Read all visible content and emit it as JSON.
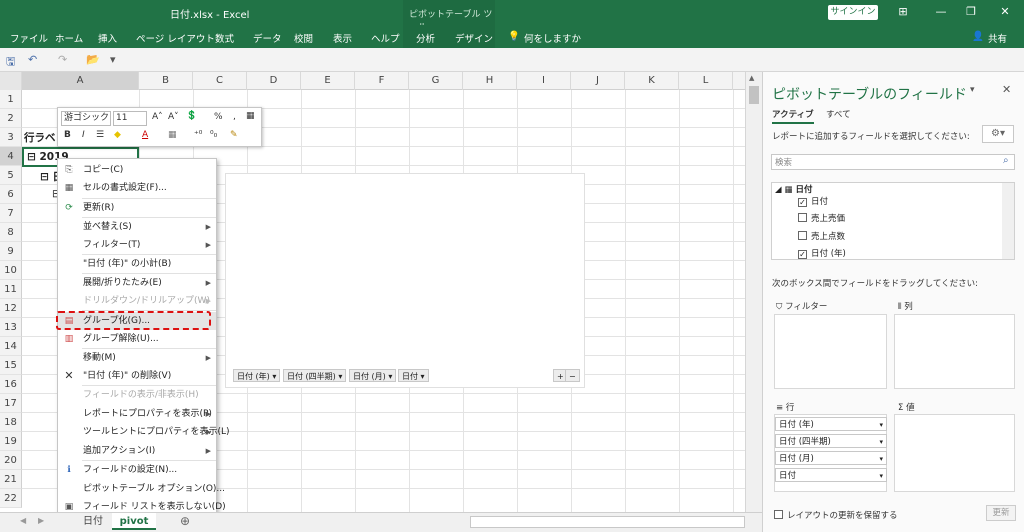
{
  "window": {
    "title": "日付.xlsx  -  Excel",
    "context_tab_group": "ピボットテーブル ツール",
    "signin": "サインイン",
    "controls": {
      "restore_ribbon": "⊞",
      "minimize": "—",
      "maximize": "❐",
      "close": "✕"
    }
  },
  "ribbon": {
    "tabs": [
      "ファイル",
      "ホーム",
      "挿入",
      "ページ レイアウト",
      "数式",
      "データ",
      "校閲",
      "表示",
      "ヘルプ",
      "分析",
      "デザイン"
    ],
    "tell_me": "何をしますか",
    "share": "共有"
  },
  "qat": {
    "save": "🖫",
    "undo": "↶",
    "redo": "↷",
    "open": "📂",
    "custom": "▾"
  },
  "name_box": "",
  "grid": {
    "columns": [
      "A",
      "B",
      "C",
      "D",
      "E",
      "F",
      "G",
      "H",
      "I",
      "J",
      "K",
      "L"
    ],
    "rows": [
      "1",
      "2",
      "3",
      "4",
      "5",
      "6",
      "7",
      "8",
      "9",
      "10",
      "11",
      "12",
      "13",
      "14",
      "15",
      "16",
      "17",
      "18",
      "19",
      "20",
      "21",
      "22"
    ],
    "cells": {
      "a3": "行ラベ",
      "a4": "⊟ 2019",
      "a5": "⊟ 日",
      "a6": "⊟"
    }
  },
  "mini_toolbar": {
    "font": "游ゴシック",
    "size": "11",
    "grow": "A˄",
    "shrink": "A˅",
    "percent": "%",
    "comma": ",",
    "bold": "B",
    "italic": "I",
    "align": "☰",
    "fill": "◆",
    "font_color": "A",
    "borders": "▦",
    "inc_decimal": "⁺⁰",
    "dec_decimal": "⁰₀",
    "format_painter": "✎"
  },
  "context_menu": {
    "items": [
      {
        "label": "コピー(C)",
        "disabled": false,
        "submenu": false,
        "icon": "⎘"
      },
      {
        "label": "セルの書式設定(F)...",
        "disabled": false,
        "submenu": false,
        "icon": "▦"
      },
      {
        "label": "更新(R)",
        "disabled": false,
        "submenu": false,
        "icon": "⟳"
      },
      {
        "label": "並べ替え(S)",
        "disabled": false,
        "submenu": true,
        "icon": ""
      },
      {
        "label": "フィルター(T)",
        "disabled": false,
        "submenu": true,
        "icon": ""
      },
      {
        "label": "\"日付 (年)\" の小計(B)",
        "disabled": false,
        "submenu": false,
        "icon": ""
      },
      {
        "label": "展開/折りたたみ(E)",
        "disabled": false,
        "submenu": true,
        "icon": ""
      },
      {
        "label": "ドリルダウン/ドリルアップ(W)",
        "disabled": true,
        "submenu": true,
        "icon": ""
      },
      {
        "label": "グループ化(G)...",
        "disabled": false,
        "submenu": false,
        "icon": "▤"
      },
      {
        "label": "グループ解除(U)...",
        "disabled": false,
        "submenu": false,
        "icon": "▥"
      },
      {
        "label": "移動(M)",
        "disabled": false,
        "submenu": true,
        "icon": ""
      },
      {
        "label": "\"日付 (年)\" の削除(V)",
        "disabled": false,
        "submenu": false,
        "icon": "✕"
      },
      {
        "label": "フィールドの表示/非表示(H)",
        "disabled": true,
        "submenu": false,
        "icon": ""
      },
      {
        "label": "レポートにプロパティを表示(P)",
        "disabled": false,
        "submenu": true,
        "icon": ""
      },
      {
        "label": "ツールヒントにプロパティを表示(L)",
        "disabled": false,
        "submenu": true,
        "icon": ""
      },
      {
        "label": "追加アクション(I)",
        "disabled": false,
        "submenu": true,
        "icon": ""
      },
      {
        "label": "フィールドの設定(N)...",
        "disabled": false,
        "submenu": false,
        "icon": "ℹ"
      },
      {
        "label": "ピボットテーブル オプション(O)...",
        "disabled": false,
        "submenu": false,
        "icon": ""
      },
      {
        "label": "フィールド リストを表示しない(D)",
        "disabled": false,
        "submenu": false,
        "icon": "▣"
      }
    ]
  },
  "pivot_chart": {
    "field_buttons": [
      "日付 (年) ▾",
      "日付 (四半期) ▾",
      "日付 (月) ▾",
      "日付 ▾"
    ],
    "zoom": [
      "+",
      "−"
    ]
  },
  "sheets": {
    "tabs": [
      "日付",
      "pivot"
    ],
    "active": "pivot",
    "add": "⊕"
  },
  "field_pane": {
    "title": "ピボットテーブルのフィールド",
    "tab_active": "アクティブ",
    "tab_all": "すべて",
    "instruction": "レポートに追加するフィールドを選択してください:",
    "search_placeholder": "検索",
    "table_name": "日付",
    "fields": [
      {
        "label": "日付",
        "checked": true
      },
      {
        "label": "売上売価",
        "checked": false
      },
      {
        "label": "売上点数",
        "checked": false
      },
      {
        "label": "日付 (年)",
        "checked": true
      }
    ],
    "drag_instruction": "次のボックス間でフィールドをドラッグしてください:",
    "area_filter": "フィルター",
    "area_columns": "列",
    "area_rows": "行",
    "area_values": "値",
    "row_fields": [
      "日付 (年)",
      "日付 (四半期)",
      "日付 (月)",
      "日付"
    ],
    "defer_update": "レイアウトの更新を保留する",
    "update_button": "更新"
  }
}
